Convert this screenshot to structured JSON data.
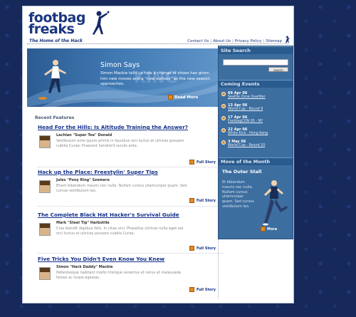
{
  "header": {
    "logo_line1": "footbag",
    "logo_line2": "freaks",
    "tagline": "The Home of the Hack",
    "nav": [
      "Contact Us",
      "About Us",
      "Privacy Policy",
      "Sitemap"
    ]
  },
  "hero": {
    "title": "Simon Says",
    "description": "Simon Mackie tells us how a change of shoes has given him new moves and a \"new outlook\" as the new season approaches.",
    "read_more": "Read More"
  },
  "features": {
    "heading": "Recent Features",
    "full_story_label": "Full Story",
    "items": [
      {
        "title": "Head For the Hills: Is Altitude Training the Answer?",
        "author": "Lachlan \"Super Toe\" Donald",
        "excerpt": "Vestibulum ante ipsum primis in faucibus orci luctus et ultrices posuere cubilia Curae; Praesent hendrerit iaculis ante."
      },
      {
        "title": "Hack up the Place: Freestylin' Super Tips",
        "author": "Jules \"Pony Ring\" Szemere",
        "excerpt": "Etiam bibendum mauris nec nulla. Nullam cursus ullamcorper quam. Sed cursus vestibulum leo."
      },
      {
        "title": "The Complete Black Hat Hacker's Survival Guide",
        "author": "Mark \"Steel Tip\" Harbottle",
        "excerpt": "Cras blandit dapibus felis. In vitae orci. Phasellus ultrices nulla eget est. orci luctus et ultrices posuere cubilia Curae;"
      },
      {
        "title": "Five Tricks You Didn't Even Know You Knew",
        "author": "Simon \"Hack Daddy\" Mackie",
        "excerpt": "Pellentesque habitant morbi tristique senectus et netus et malesuada fames ac turpis egestas."
      }
    ]
  },
  "sidebar": {
    "search_heading": "Site Search",
    "search_value": "",
    "search_button": "search",
    "events_heading": "Coming Events",
    "events": [
      {
        "date": "09 Apr 06",
        "title": "Seattle Zone Qualifier"
      },
      {
        "date": "13 Apr 06",
        "title": "World Cup - Round 9"
      },
      {
        "date": "17 Apr 06",
        "title": "FootbagCON 05 - NY"
      },
      {
        "date": "22 Apr 06",
        "title": "White Kick - Hong Kong"
      },
      {
        "date": "3 May 06",
        "title": "World Cup - Round 10"
      }
    ],
    "motm_heading": "Move of the Month",
    "motm_title": "The Outer Stall",
    "motm_text": "Et bibendum mauris nec nulla. Nullam cursus ullamcorper quam. Sed cursus vestibulum leo.",
    "motm_more": "More"
  },
  "colors": {
    "background": "#16295a",
    "brand_blue": "#1a3680",
    "accent_orange": "#e08a24",
    "sidebar_blue": "#3d6ea0"
  }
}
